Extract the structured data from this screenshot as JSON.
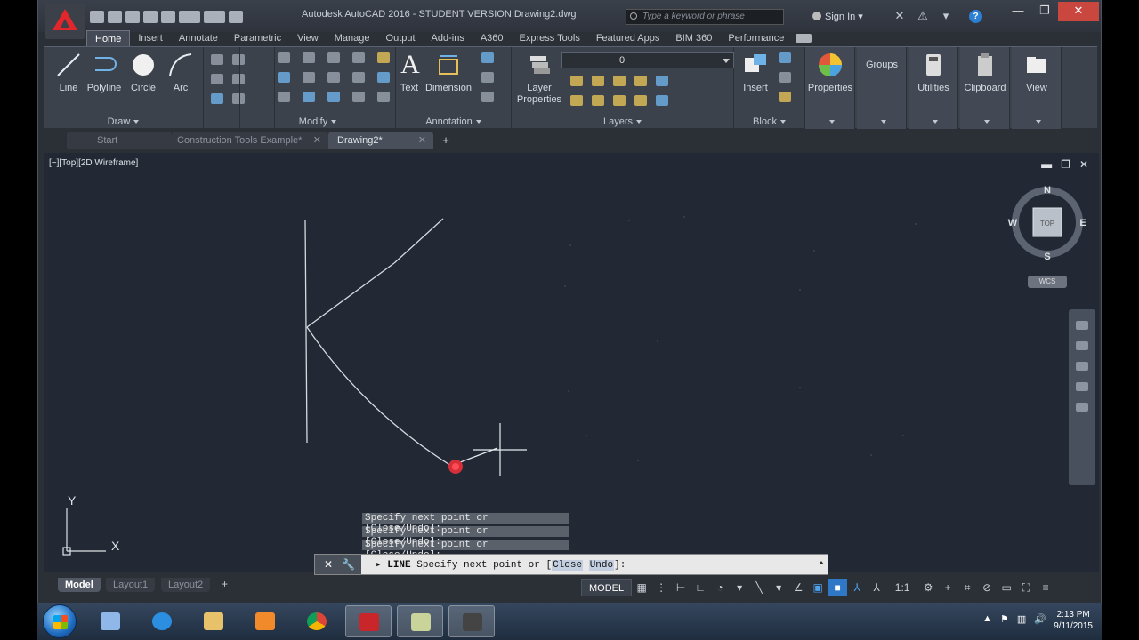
{
  "title_bar": {
    "title": "Autodesk AutoCAD 2016 - STUDENT VERSION    Drawing2.dwg",
    "search_placeholder": "Type a keyword or phrase",
    "signin": "Sign In"
  },
  "ribbon_tabs": [
    "Home",
    "Insert",
    "Annotate",
    "Parametric",
    "View",
    "Manage",
    "Output",
    "Add-ins",
    "A360",
    "Express Tools",
    "Featured Apps",
    "BIM 360",
    "Performance"
  ],
  "ribbon": {
    "draw_tools": [
      "Line",
      "Polyline",
      "Circle",
      "Arc"
    ],
    "draw_panel": "Draw",
    "modify_panel": "Modify",
    "annotation_tools": [
      "Text",
      "Dimension"
    ],
    "annotation_panel": "Annotation",
    "layer_properties": "Layer\nProperties",
    "layer_value": "0",
    "layers_panel": "Layers",
    "insert": "Insert",
    "block_panel": "Block",
    "properties": "Properties",
    "groups": "Groups",
    "utilities": "Utilities",
    "clipboard": "Clipboard",
    "view": "View"
  },
  "file_tabs": [
    {
      "label": "Start",
      "active": false
    },
    {
      "label": "Construction Tools Example*",
      "active": false
    },
    {
      "label": "Drawing2*",
      "active": true
    }
  ],
  "viewport": {
    "label": "[−][Top][2D Wireframe]",
    "viewcube": {
      "top": "TOP",
      "n": "N",
      "s": "S",
      "e": "E",
      "w": "W",
      "wcs": "WCS"
    },
    "ucs": {
      "x": "X",
      "y": "Y"
    }
  },
  "command": {
    "history": [
      "Specify next point or [Close/Undo]:",
      "Specify next point or [Close/Undo]:",
      "Specify next point or [Close/Undo]:"
    ],
    "prompt_cmd": "LINE",
    "prompt_text": "Specify next point or [",
    "prompt_opt1": "Close",
    "prompt_opt2": "Undo",
    "prompt_end": "]:"
  },
  "layout_tabs": [
    "Model",
    "Layout1",
    "Layout2"
  ],
  "status": {
    "model": "MODEL",
    "scale": "1:1"
  },
  "taskbar": {
    "time": "2:13 PM",
    "date": "9/11/2015"
  }
}
